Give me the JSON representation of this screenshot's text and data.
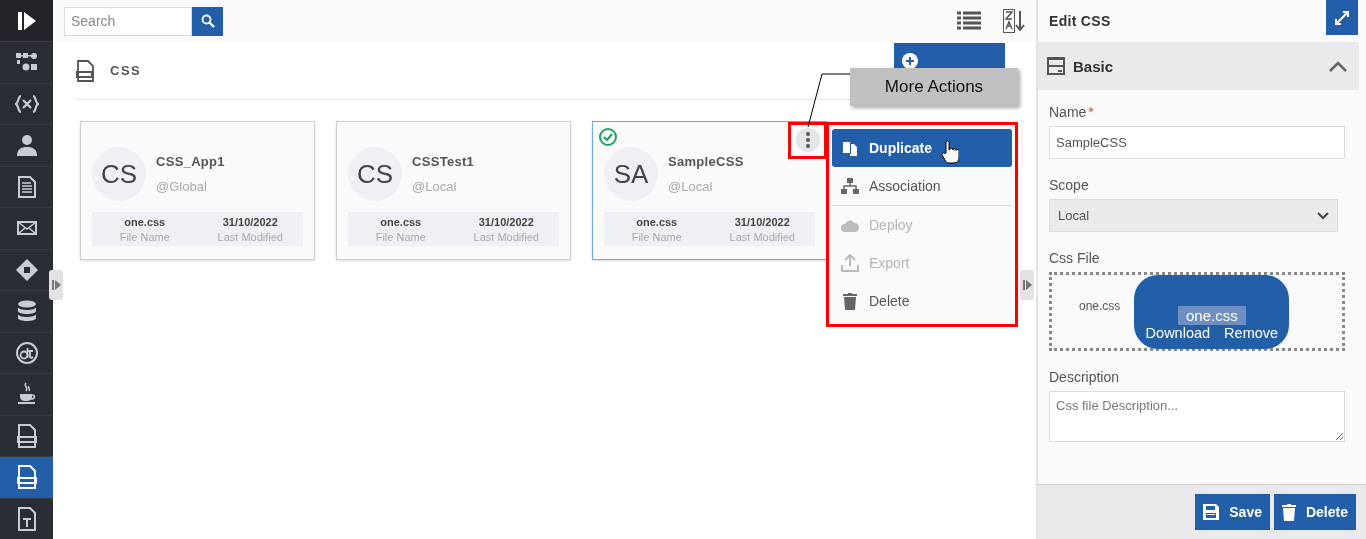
{
  "sidebar": {
    "items": [
      {
        "kind": "flow",
        "selected": false
      },
      {
        "kind": "variable",
        "selected": false
      },
      {
        "kind": "user",
        "selected": false
      },
      {
        "kind": "document",
        "selected": false
      },
      {
        "kind": "mail",
        "selected": false
      },
      {
        "kind": "decision",
        "selected": false
      },
      {
        "kind": "database",
        "selected": false
      },
      {
        "kind": "datatable",
        "selected": false
      },
      {
        "kind": "java",
        "selected": false
      },
      {
        "kind": "script-file",
        "selected": false
      },
      {
        "kind": "css-file",
        "selected": true
      },
      {
        "kind": "text-file",
        "selected": false
      }
    ]
  },
  "search": {
    "placeholder": "Search"
  },
  "page": {
    "title": "CSS"
  },
  "cards": [
    {
      "initials": "CS",
      "name": "CSS_App1",
      "scope": "@Global",
      "file": "one.css",
      "file_label": "File Name",
      "date": "31/10/2022",
      "date_label": "Last Modified",
      "selected": false
    },
    {
      "initials": "CS",
      "name": "CSSTest1",
      "scope": "@Local",
      "file": "one.css",
      "file_label": "File Name",
      "date": "31/10/2022",
      "date_label": "Last Modified",
      "selected": false
    },
    {
      "initials": "SA",
      "name": "SampleCSS",
      "scope": "@Local",
      "file": "one.css",
      "file_label": "File Name",
      "date": "31/10/2022",
      "date_label": "Last Modified",
      "selected": true
    }
  ],
  "callout": {
    "text": "More Actions"
  },
  "menu": {
    "items": [
      {
        "kind": "duplicate",
        "label": "Duplicate",
        "highlighted": true,
        "disabled": false,
        "divider_after": false
      },
      {
        "kind": "association",
        "label": "Association",
        "highlighted": false,
        "disabled": false,
        "divider_after": true
      },
      {
        "kind": "deploy",
        "label": "Deploy",
        "highlighted": false,
        "disabled": true,
        "divider_after": false
      },
      {
        "kind": "export",
        "label": "Export",
        "highlighted": false,
        "disabled": true,
        "divider_after": false
      },
      {
        "kind": "delete",
        "label": "Delete",
        "highlighted": false,
        "disabled": false,
        "divider_after": false
      }
    ]
  },
  "panel": {
    "title": "Edit CSS",
    "section": {
      "title": "Basic",
      "expanded": true
    },
    "name": {
      "label": "Name",
      "required_mark": "*",
      "value": "SampleCSS"
    },
    "scope": {
      "label": "Scope",
      "value": "Local"
    },
    "css_file": {
      "label": "Css File",
      "file": "one.css",
      "preview_name": "one.css",
      "download": "Download",
      "remove": "Remove"
    },
    "description": {
      "label": "Description",
      "placeholder": "Css file Description..."
    },
    "buttons": [
      {
        "kind": "save",
        "label": "Save"
      },
      {
        "kind": "delete",
        "label": "Delete"
      }
    ]
  }
}
